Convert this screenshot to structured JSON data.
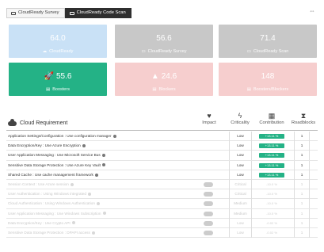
{
  "tabs": [
    {
      "label": "CloudReady Survey",
      "active": false
    },
    {
      "label": "CloudReady Code Scan",
      "active": true
    }
  ],
  "cards": {
    "row1": [
      {
        "value": "64.0",
        "label": "CloudReady",
        "color": "#c9e1f6"
      },
      {
        "value": "56.6",
        "label": "CloudReady Survey",
        "color": "#c8c8c8"
      },
      {
        "value": "71.4",
        "label": "CloudReady Scan",
        "color": "#c8c8c8"
      }
    ],
    "row2": [
      {
        "value": "55.6",
        "label": "Boosters",
        "color": "#24b286",
        "icon": "rocket-icon"
      },
      {
        "value": "24.6",
        "label": "Blockers",
        "color": "#f6cece",
        "icon": "warning-icon"
      },
      {
        "value": "148",
        "label": "Boosters/Blockers",
        "color": "#f6cece",
        "icon": ""
      }
    ]
  },
  "section": {
    "title": "Cloud Requirement"
  },
  "columns": {
    "impact": "Impact",
    "criticality": "Criticality",
    "contribution": "Contribution",
    "roadblocks": "Roadblocks"
  },
  "rows": [
    {
      "text": "Application Settings/Configuration : Use configuration manager",
      "criticality": "Low",
      "contribution": "+13.11 %",
      "roadblocks": "1",
      "faded": false
    },
    {
      "text": "Data Encryption/Key : Use Azure Encryption",
      "criticality": "Low",
      "contribution": "+13.11 %",
      "roadblocks": "1",
      "faded": false
    },
    {
      "text": "User Application Messaging : Use Microsoft Service Bus",
      "criticality": "Low",
      "contribution": "+13.11 %",
      "roadblocks": "1",
      "faded": false
    },
    {
      "text": "Sensitive Data Storage Protection : Use Azure Key Vault",
      "criticality": "Low",
      "contribution": "+13.11 %",
      "roadblocks": "1",
      "faded": false
    },
    {
      "text": "Shared Cache : Use cache management framework",
      "criticality": "Low",
      "contribution": "+13.11 %",
      "roadblocks": "1",
      "faded": false
    },
    {
      "text": "Session Context : Use Azure session",
      "criticality": "Critical",
      "contribution": "-10.0 %",
      "roadblocks": "1",
      "faded": true
    },
    {
      "text": "User Authentication : Using Windows integrated",
      "criticality": "Critical",
      "contribution": "-10.0 %",
      "roadblocks": "1",
      "faded": true
    },
    {
      "text": "Cloud Authentication : Using Windows Authentication",
      "criticality": "Medium",
      "contribution": "-10.0 %",
      "roadblocks": "1",
      "faded": true
    },
    {
      "text": "User Application Messaging : Use Windows Subscription",
      "criticality": "Medium",
      "contribution": "-10.0 %",
      "roadblocks": "1",
      "faded": true
    },
    {
      "text": "Data Encryption/Key : Use Crypto API",
      "criticality": "Low",
      "contribution": "-0.02 %",
      "roadblocks": "1",
      "faded": true
    },
    {
      "text": "Sensitive Data Storage Protection : DPAPI access",
      "criticality": "Low",
      "contribution": "-0.02 %",
      "roadblocks": "1",
      "faded": true
    }
  ],
  "colors": {
    "contribution_positive": "#24b286"
  }
}
